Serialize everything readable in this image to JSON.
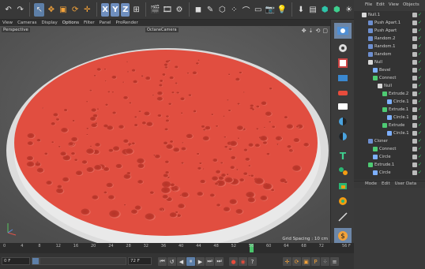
{
  "toolbar": {
    "axis_x": "X",
    "axis_y": "Y",
    "axis_z": "Z"
  },
  "menu": {
    "items": [
      "Perspective",
      "View",
      "Cameras",
      "Display",
      "Options",
      "Filter",
      "Panel",
      "ProRender"
    ]
  },
  "viewport": {
    "label": "Perspective",
    "camera": "OctaneCamera",
    "grid_spacing": "Grid Spacing : 10 cm"
  },
  "object_manager": {
    "menu": [
      "File",
      "Edit",
      "View",
      "Objects"
    ],
    "rows": [
      {
        "label": "Null.1",
        "icon": "null-icon",
        "color": "#d9d9d9"
      },
      {
        "label": "Push Apart.1",
        "icon": "effector-icon",
        "color": "#6d8fd0"
      },
      {
        "label": "Push Apart",
        "icon": "effector-icon",
        "color": "#6d8fd0"
      },
      {
        "label": "Random.2",
        "icon": "effector-icon",
        "color": "#6d8fd0"
      },
      {
        "label": "Random.1",
        "icon": "effector-icon",
        "color": "#6d8fd0"
      },
      {
        "label": "Random",
        "icon": "effector-icon",
        "color": "#6d8fd0"
      },
      {
        "label": "Null",
        "icon": "null-icon",
        "color": "#d9d9d9"
      },
      {
        "label": "Bevel",
        "icon": "deformer-icon",
        "color": "#7db0ff"
      },
      {
        "label": "Connect",
        "icon": "connect-icon",
        "color": "#4ecb73"
      },
      {
        "label": "Null",
        "icon": "null-icon",
        "color": "#d9d9d9"
      },
      {
        "label": "Extrude.2",
        "icon": "extrude-icon",
        "color": "#4ecb73"
      },
      {
        "label": "Circle.1",
        "icon": "spline-icon",
        "color": "#7db0ff"
      },
      {
        "label": "Extrude.1",
        "icon": "extrude-icon",
        "color": "#4ecb73"
      },
      {
        "label": "Circle.1",
        "icon": "spline-icon",
        "color": "#7db0ff"
      },
      {
        "label": "Extrude",
        "icon": "extrude-icon",
        "color": "#4ecb73"
      },
      {
        "label": "Circle.1",
        "icon": "spline-icon",
        "color": "#7db0ff"
      },
      {
        "label": "Cloner",
        "icon": "cloner-icon",
        "color": "#6d8fd0"
      },
      {
        "label": "Connect",
        "icon": "connect-icon",
        "color": "#4ecb73"
      },
      {
        "label": "Circle",
        "icon": "spline-icon",
        "color": "#7db0ff"
      },
      {
        "label": "Extrude.1",
        "icon": "extrude-icon",
        "color": "#4ecb73"
      },
      {
        "label": "Circle",
        "icon": "spline-icon",
        "color": "#7db0ff"
      }
    ]
  },
  "attributes": {
    "menu": [
      "Mode",
      "Edit",
      "User Data"
    ]
  },
  "timeline": {
    "ticks": [
      "0",
      "4",
      "8",
      "12",
      "16",
      "20",
      "24",
      "28",
      "32",
      "36",
      "40",
      "44",
      "48",
      "52",
      "56",
      "60",
      "64",
      "68",
      "72"
    ],
    "end_label": "56 F",
    "current_frame": 56
  },
  "transport": {
    "start_field": "0 F",
    "min_field": "0 F",
    "max_field": "72 F",
    "end_field": "72 F"
  },
  "colors": {
    "liquid": "#e14e40",
    "selection": "#5d7fa8"
  }
}
